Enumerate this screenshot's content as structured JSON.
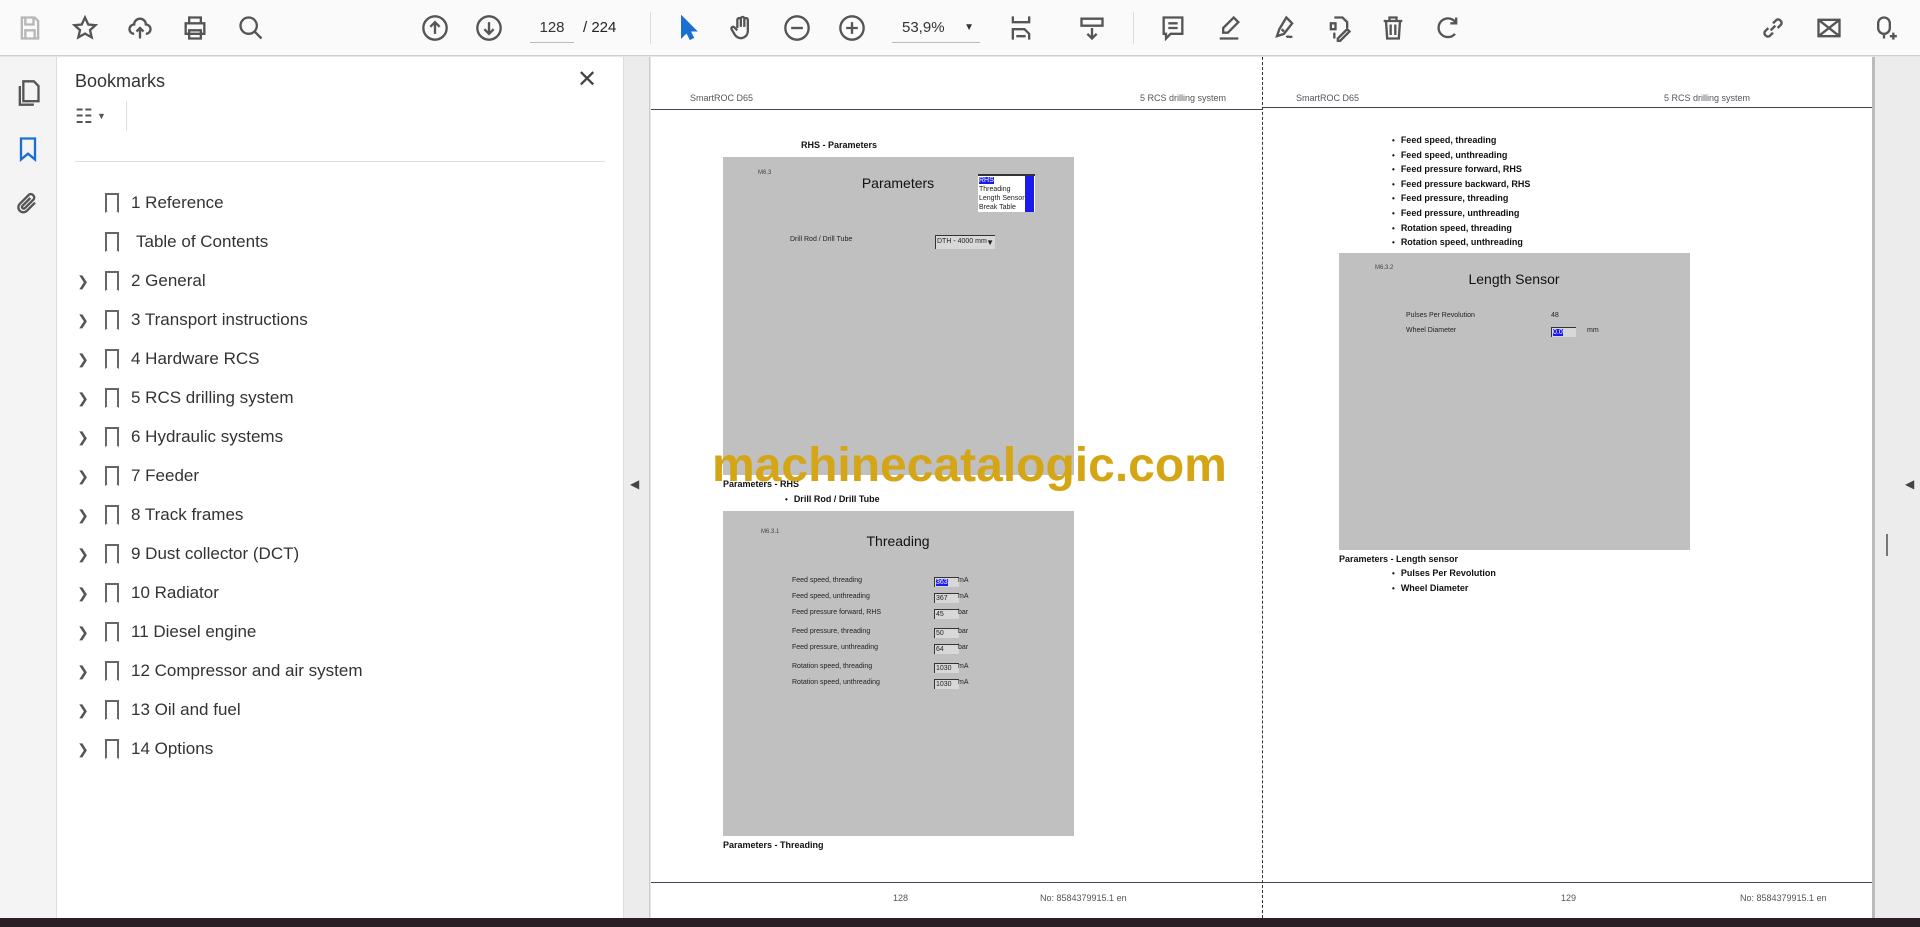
{
  "toolbar": {
    "page_current": "128",
    "page_total": "/ 224",
    "zoom": "53,9%"
  },
  "bookmarks": {
    "title": "Bookmarks",
    "items": [
      {
        "label": "1 Reference",
        "expandable": false
      },
      {
        "label": "Table of Contents",
        "expandable": false
      },
      {
        "label": "2 General",
        "expandable": true
      },
      {
        "label": "3 Transport instructions",
        "expandable": true
      },
      {
        "label": "4 Hardware RCS",
        "expandable": true
      },
      {
        "label": "5 RCS drilling system",
        "expandable": true
      },
      {
        "label": "6 Hydraulic systems",
        "expandable": true
      },
      {
        "label": "7 Feeder",
        "expandable": true
      },
      {
        "label": "8 Track frames",
        "expandable": true
      },
      {
        "label": "9 Dust collector (DCT)",
        "expandable": true
      },
      {
        "label": "10 Radiator",
        "expandable": true
      },
      {
        "label": "11 Diesel engine",
        "expandable": true
      },
      {
        "label": "12 Compressor and air system",
        "expandable": true
      },
      {
        "label": "13 Oil and fuel",
        "expandable": true
      },
      {
        "label": "14 Options",
        "expandable": true
      }
    ]
  },
  "page1": {
    "header_left": "SmartROC D65",
    "header_right": "5 RCS drilling system",
    "section_title": "RHS - Parameters",
    "fig1": {
      "id": "M6.3",
      "title": "Parameters",
      "list": [
        "RHS",
        "Threading",
        "Length Sensor",
        "Break Table"
      ],
      "field_label": "Drill Rod / Drill Tube",
      "field_value": "DTH - 4000 mm",
      "caption": "Parameters - RHS"
    },
    "bullets1": [
      "Drill Rod / Drill Tube"
    ],
    "fig2": {
      "id": "M6.3.1",
      "title": "Threading",
      "rows": [
        {
          "label": "Feed speed, threading",
          "value": "363",
          "unit": "mA"
        },
        {
          "label": "Feed speed, unthreading",
          "value": "367",
          "unit": "mA"
        },
        {
          "label": "Feed pressure forward, RHS",
          "value": "45",
          "unit": "bar"
        },
        {
          "label": "Feed pressure, threading",
          "value": "50",
          "unit": "bar"
        },
        {
          "label": "Feed pressure, unthreading",
          "value": "64",
          "unit": "bar"
        },
        {
          "label": "Rotation speed, threading",
          "value": "1030",
          "unit": "mA"
        },
        {
          "label": "Rotation speed, unthreading",
          "value": "1030",
          "unit": "mA"
        }
      ],
      "caption": "Parameters - Threading"
    },
    "page_number": "128",
    "doc_no": "No: 8584379915.1 en"
  },
  "page2": {
    "header_left": "SmartROC D65",
    "header_right": "5 RCS drilling system",
    "bullets": [
      "Feed speed, threading",
      "Feed speed, unthreading",
      "Feed pressure forward, RHS",
      "Feed pressure backward, RHS",
      "Feed pressure, threading",
      "Feed pressure, unthreading",
      "Rotation speed, threading",
      "Rotation speed, unthreading"
    ],
    "fig": {
      "id": "M6.3.2",
      "title": "Length Sensor",
      "pulses_label": "Pulses Per Revolution",
      "pulses_value": "48",
      "wheel_label": "Wheel Diameter",
      "wheel_value": "0.0",
      "wheel_unit": "mm",
      "caption": "Parameters - Length sensor"
    },
    "bullets2": [
      "Pulses Per Revolution",
      "Wheel Diameter"
    ],
    "page_number": "129",
    "doc_no": "No: 8584379915.1 en"
  },
  "watermark": "machinecatalogic.com"
}
